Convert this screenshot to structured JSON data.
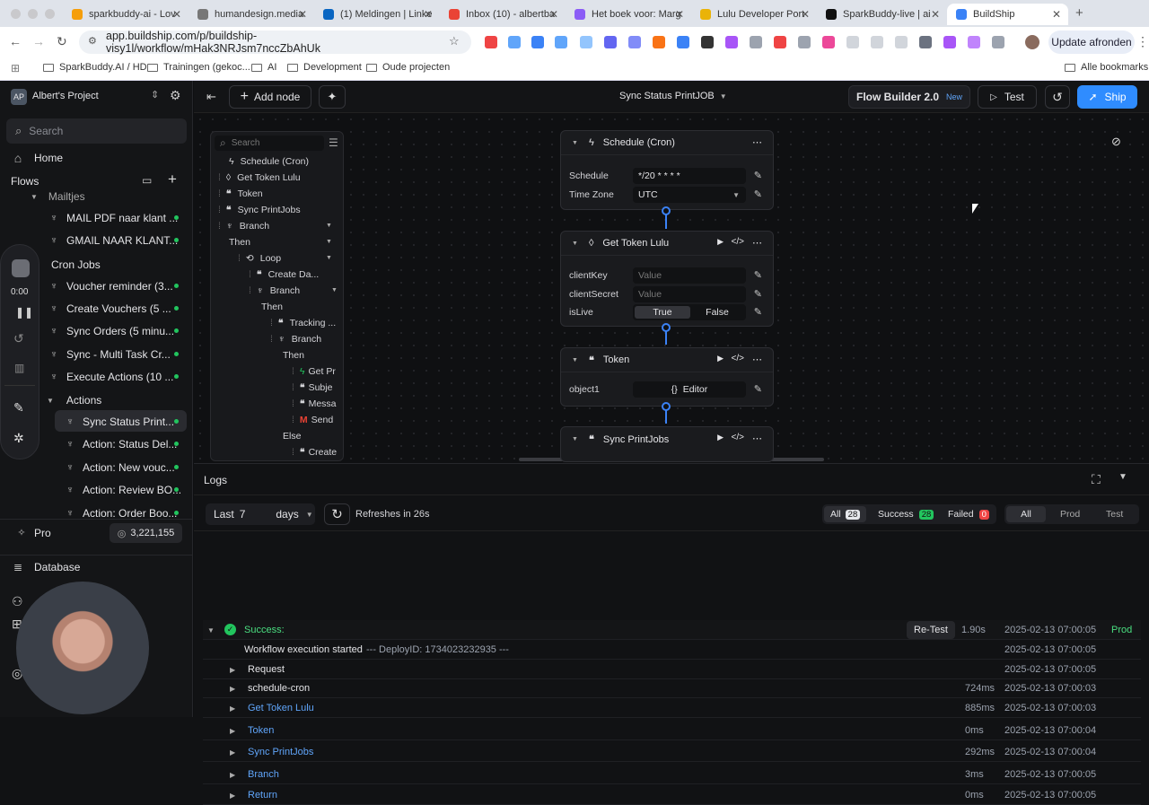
{
  "browser": {
    "tabs": [
      "sparkbuddy-ai - Lov",
      "humandesign.media",
      "(1) Meldingen | Linke",
      "Inbox (10) - albertba",
      "Het boek voor: Marg",
      "Lulu Developer Port",
      "SparkBuddy-live | ai",
      "BuildShip"
    ],
    "url": "app.buildship.com/p/buildship-visy1l/workflow/mHak3NRJsm7nccZbAhUk",
    "update_label": "Update afronden",
    "bookmarks": [
      "SparkBuddy.AI / HD",
      "Trainingen (gekoc...",
      "AI",
      "Development",
      "Oude projecten"
    ],
    "all_bookmarks": "Alle bookmarks"
  },
  "sidebar": {
    "project_badge": "AP",
    "project": "Albert's Project",
    "search_placeholder": "Search",
    "home": "Home",
    "flows": "Flows",
    "groups": [
      {
        "label": "Mailtjes",
        "items": [
          "MAIL PDF naar klant ...",
          "GMAIL NAAR KLANT..."
        ]
      },
      {
        "label": "Cron Jobs",
        "items": [
          "Voucher reminder (3...",
          "Create Vouchers (5 ...",
          "Sync Orders (5 minu...",
          "Sync - Multi Task Cr...",
          "Execute Actions (10 ..."
        ]
      },
      {
        "label": "Actions",
        "items": [
          "Sync Status Print...",
          "Action: Status Del...",
          "Action: New vouc...",
          "Action: Review BO...",
          "Action: Order Boo..."
        ]
      }
    ],
    "pro": "Pro",
    "credits": "3,221,155",
    "database": "Database",
    "recorder_time": "0:00"
  },
  "topbar": {
    "add_node": "Add node",
    "workflow_name": "Sync Status PrintJOB",
    "builder": "Flow Builder 2.0",
    "builder_badge": "New",
    "test": "Test",
    "ship": "Ship"
  },
  "tree": {
    "search_placeholder": "Search",
    "rows": [
      "Schedule (Cron)",
      "Get Token Lulu",
      "Token",
      "Sync PrintJobs",
      "Branch",
      "Then",
      "Loop",
      "Create Da...",
      "Branch",
      "Then",
      "Tracking ...",
      "Branch",
      "Then",
      "Get Pr",
      "Subje",
      "Messa",
      "Send",
      "Else",
      "Create"
    ]
  },
  "nodes": {
    "schedule": {
      "title": "Schedule (Cron)",
      "f1": "Schedule",
      "v1": "*/20 * * * *",
      "f2": "Time Zone",
      "v2": "UTC"
    },
    "token_lulu": {
      "title": "Get Token Lulu",
      "f1": "clientKey",
      "f2": "clientSecret",
      "f3": "isLive",
      "ph": "Value",
      "t": "True",
      "f": "False"
    },
    "token": {
      "title": "Token",
      "f1": "object1",
      "v1": "Editor"
    },
    "sync": {
      "title": "Sync PrintJobs"
    }
  },
  "logs": {
    "title": "Logs",
    "last": "Last",
    "num": "7",
    "unit": "days",
    "refresh": "Refreshes in 26s",
    "filter_all": "All",
    "count_all": "28",
    "filter_success": "Success",
    "count_success": "28",
    "filter_failed": "Failed",
    "count_failed": "0",
    "env": [
      "All",
      "Prod",
      "Test"
    ],
    "status": "Success:",
    "retest": "Re-Test",
    "duration": "1.90s",
    "main_ts": "2025-02-13  07:00:05",
    "env_label": "Prod",
    "started": "Workflow execution started",
    "deploy": "--- DeployID: 1734023232935 ---",
    "rows": [
      {
        "name": "Request",
        "ms": "",
        "ts": "2025-02-13  07:00:05"
      },
      {
        "name": "schedule-cron",
        "ms": "724ms",
        "ts": "2025-02-13  07:00:03"
      },
      {
        "name": "Get Token Lulu",
        "ms": "885ms",
        "ts": "2025-02-13  07:00:03"
      },
      {
        "name": "Token",
        "ms": "0ms",
        "ts": "2025-02-13  07:00:04"
      },
      {
        "name": "Sync PrintJobs",
        "ms": "292ms",
        "ts": "2025-02-13  07:00:04"
      },
      {
        "name": "Branch",
        "ms": "3ms",
        "ts": "2025-02-13  07:00:05"
      },
      {
        "name": "Return",
        "ms": "0ms",
        "ts": "2025-02-13  07:00:05"
      }
    ]
  }
}
